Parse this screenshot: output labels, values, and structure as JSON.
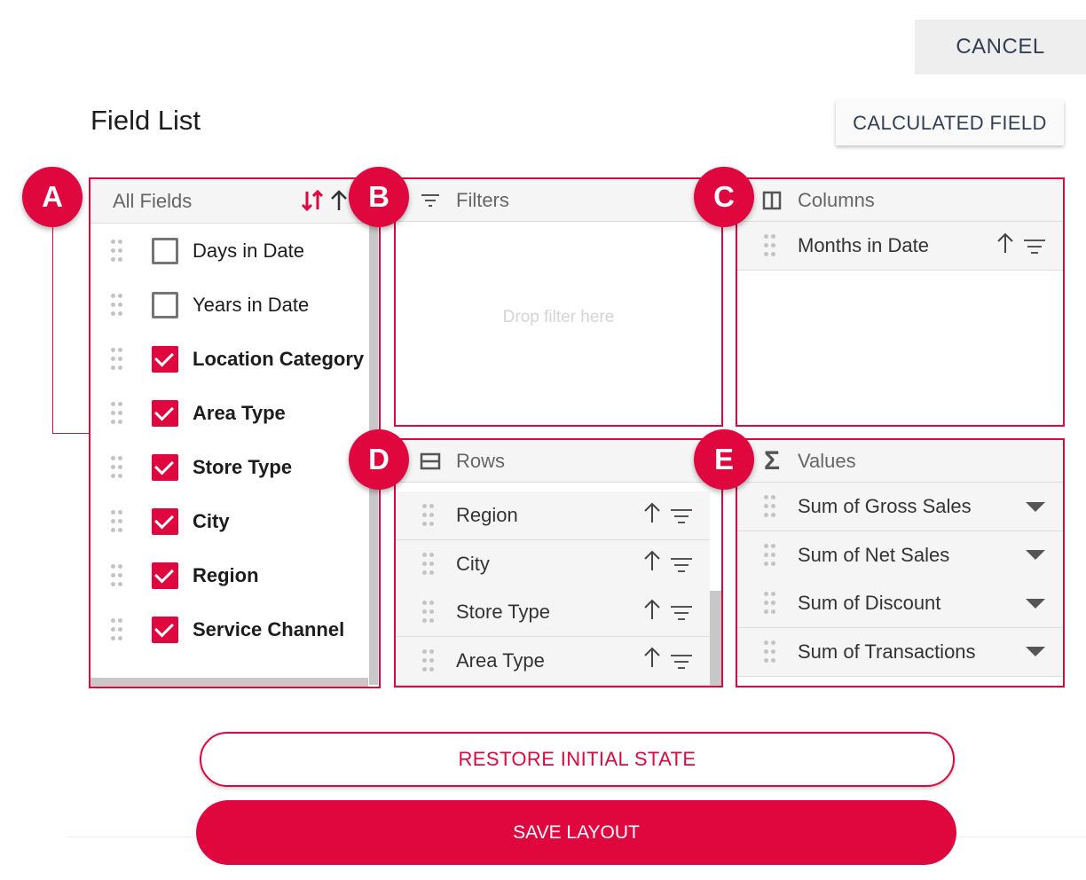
{
  "header": {
    "cancel_label": "CANCEL",
    "title": "Field List",
    "calculated_field_label": "CALCULATED FIELD"
  },
  "badges": [
    "A",
    "B",
    "C",
    "D",
    "E"
  ],
  "all_fields": {
    "header_label": "All Fields",
    "sort_icons": [
      "sort-toggle-icon",
      "sort-ascending-icon",
      "sort-descending-icon"
    ],
    "items": [
      {
        "label": "Days in Date",
        "checked": false
      },
      {
        "label": "Years in Date",
        "checked": false
      },
      {
        "label": "Location Category",
        "checked": true
      },
      {
        "label": "Area Type",
        "checked": true
      },
      {
        "label": "Store Type",
        "checked": true
      },
      {
        "label": "City",
        "checked": true
      },
      {
        "label": "Region",
        "checked": true
      },
      {
        "label": "Service Channel",
        "checked": true
      }
    ]
  },
  "filters": {
    "header_label": "Filters",
    "drop_hint": "Drop filter here"
  },
  "columns": {
    "header_label": "Columns",
    "items": [
      {
        "label": "Months in Date"
      }
    ]
  },
  "rows": {
    "header_label": "Rows",
    "items": [
      {
        "label": "Region"
      },
      {
        "label": "City"
      },
      {
        "label": "Store Type"
      },
      {
        "label": "Area Type"
      }
    ]
  },
  "values": {
    "header_label": "Values",
    "items": [
      {
        "label": "Sum of Gross Sales"
      },
      {
        "label": "Sum of Net Sales"
      },
      {
        "label": "Sum of Discount"
      },
      {
        "label": "Sum of Transactions"
      }
    ]
  },
  "footer": {
    "restore_label": "RESTORE INITIAL STATE",
    "save_label": "SAVE LAYOUT"
  },
  "colors": {
    "accent": "#e0073f",
    "panel_header_bg": "#f5f5f5",
    "button_text": "#333f55"
  }
}
